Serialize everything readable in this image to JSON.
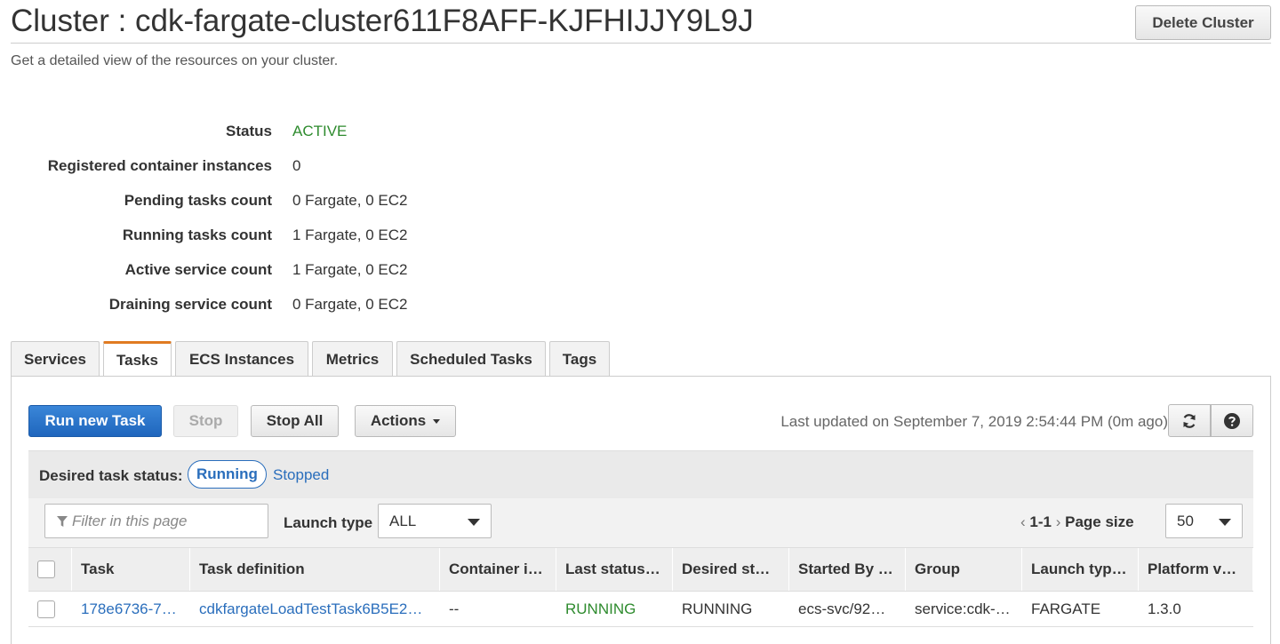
{
  "header": {
    "title": "Cluster : cdk-fargate-cluster611F8AFF-KJFHIJJY9L9J",
    "delete_label": "Delete Cluster",
    "subtitle": "Get a detailed view of the resources on your cluster."
  },
  "details": [
    {
      "label": "Status",
      "value": "ACTIVE"
    },
    {
      "label": "Registered container instances",
      "value": "0"
    },
    {
      "label": "Pending tasks count",
      "value": "0 Fargate, 0 EC2"
    },
    {
      "label": "Running tasks count",
      "value": "1 Fargate, 0 EC2"
    },
    {
      "label": "Active service count",
      "value": "1 Fargate, 0 EC2"
    },
    {
      "label": "Draining service count",
      "value": "0 Fargate, 0 EC2"
    }
  ],
  "colors": {
    "active": "#2e8b2e",
    "link": "#2a6ebc",
    "tab_accent": "#e07b22",
    "primary": "#1f66bd"
  },
  "tabs": [
    "Services",
    "Tasks",
    "ECS Instances",
    "Metrics",
    "Scheduled Tasks",
    "Tags"
  ],
  "selected_tab": "Tasks",
  "toolbar": {
    "run_label": "Run new Task",
    "stop_label": "Stop",
    "stop_all_label": "Stop All",
    "actions_label": "Actions",
    "last_updated": "Last updated on September 7, 2019 2:54:44 PM (0m ago)",
    "refresh_icon": "refresh-icon",
    "help_icon": "help-icon"
  },
  "status_filter": {
    "label": "Desired task status:",
    "running": "Running",
    "stopped": "Stopped"
  },
  "filters": {
    "placeholder": "Filter in this page",
    "launch_type_label": "Launch type",
    "launch_type_value": "ALL",
    "pager_range": "1-1",
    "page_size_label": "Page size",
    "page_size_value": "50"
  },
  "table": {
    "columns": [
      "Task",
      "Task definition",
      "Container i…",
      "Last status…",
      "Desired st…",
      "Started By …",
      "Group",
      "Launch typ…",
      "Platform v…"
    ],
    "rows": [
      [
        "178e6736-7…",
        "cdkfargateLoadTestTask6B5E2…",
        "--",
        "RUNNING",
        "RUNNING",
        "ecs-svc/92…",
        "service:cdk-…",
        "FARGATE",
        "1.3.0"
      ]
    ]
  }
}
